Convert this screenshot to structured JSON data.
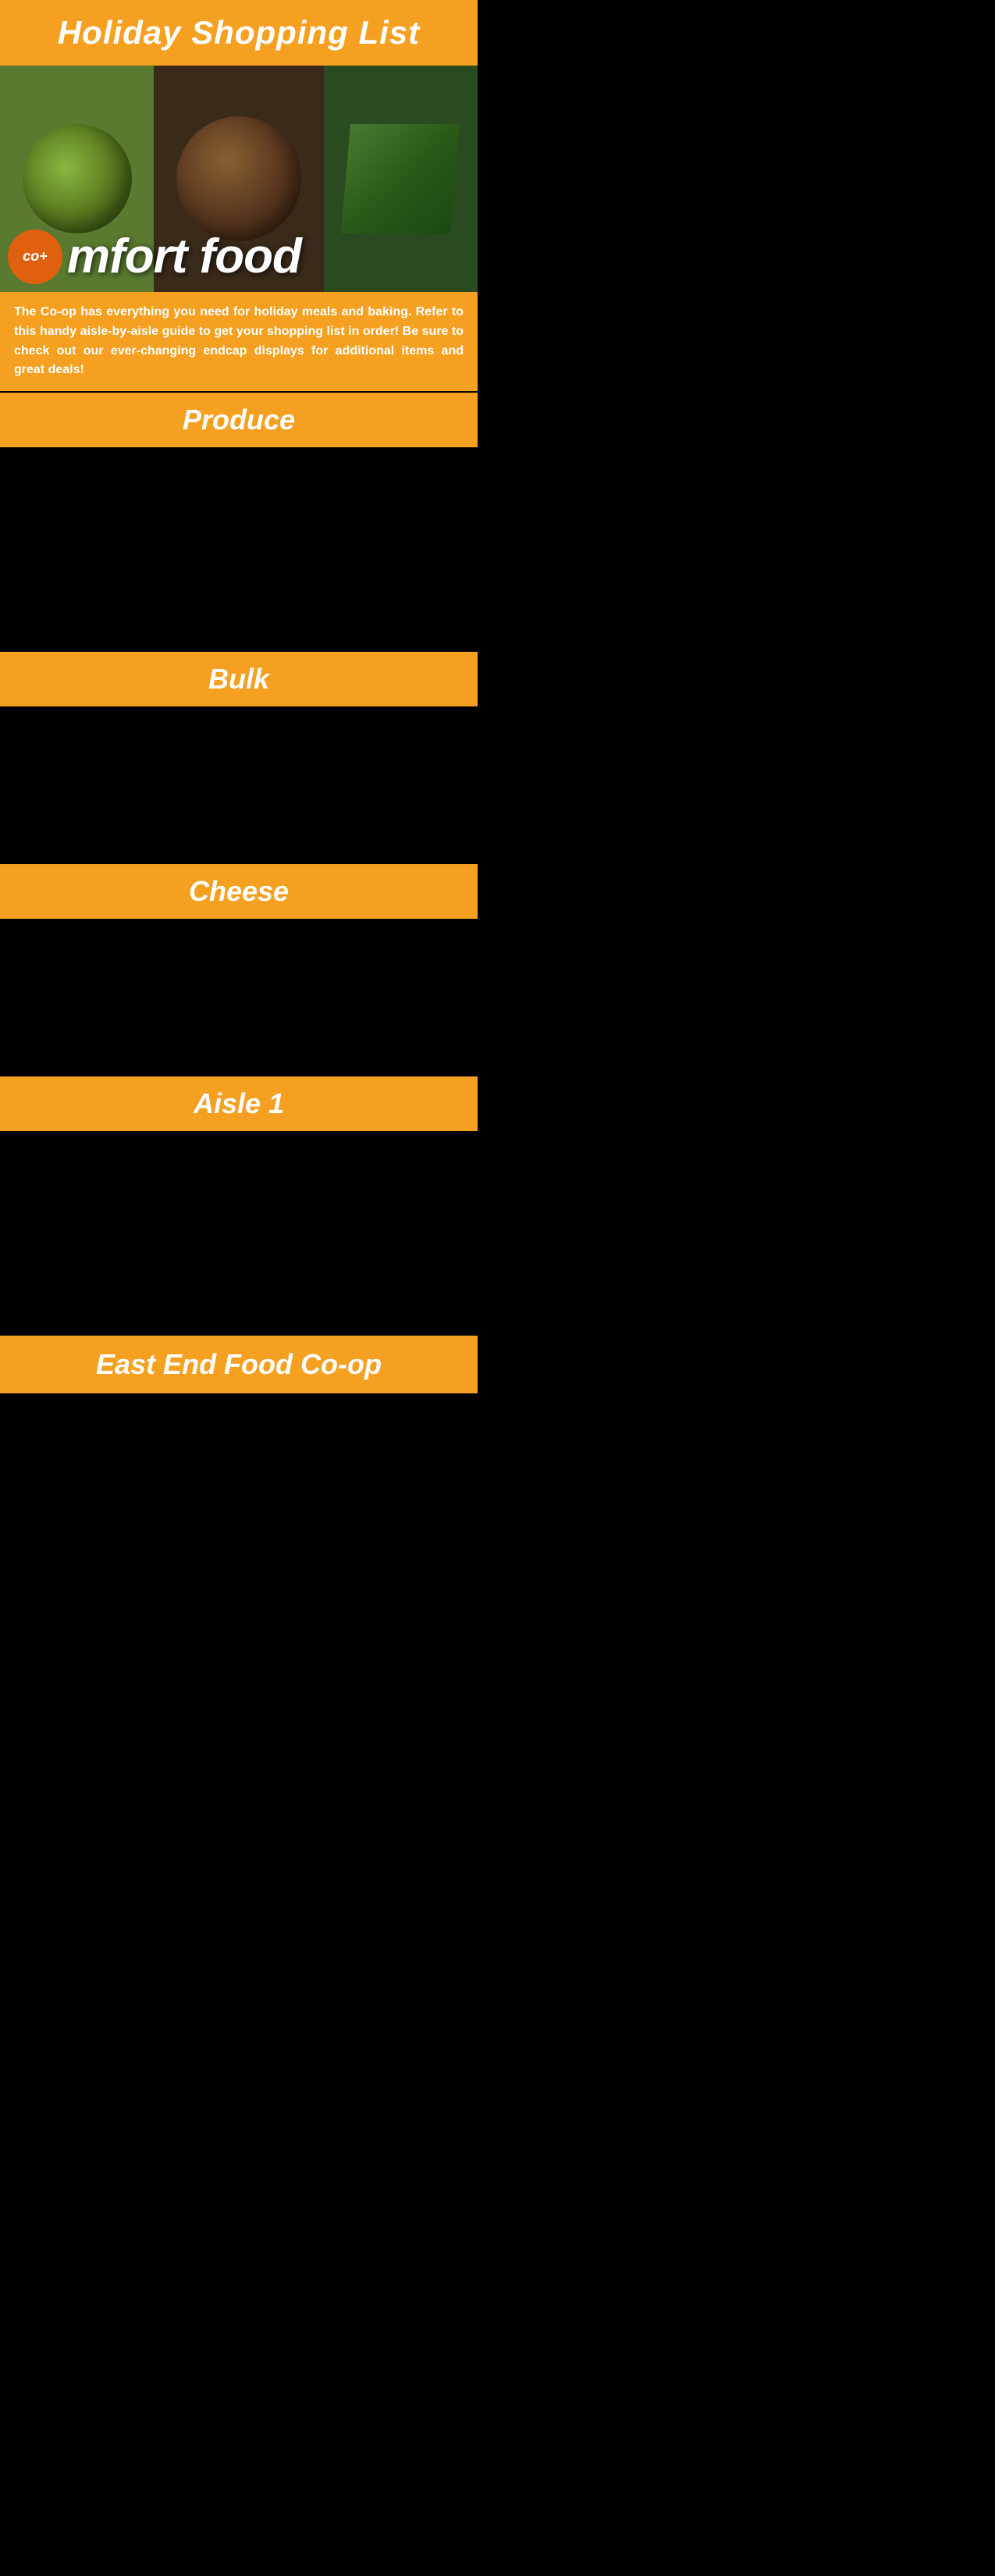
{
  "header": {
    "title": "Holiday Shopping List"
  },
  "hero": {
    "logo_text": "co+",
    "comfort_food_text": "mfort food"
  },
  "description": {
    "text": "The Co-op has everything you need for holiday meals and baking. Refer to this handy aisle-by-aisle guide to get your shopping list in order! Be sure to check out our ever-changing endcap displays for additional items and great deals!"
  },
  "sections": [
    {
      "id": "produce",
      "label": "Produce",
      "items": []
    },
    {
      "id": "bulk",
      "label": "Bulk",
      "items": []
    },
    {
      "id": "cheese",
      "label": "Cheese",
      "items": []
    },
    {
      "id": "aisle1",
      "label": "Aisle 1",
      "items": []
    }
  ],
  "footer": {
    "label": "East End Food Co-op"
  },
  "colors": {
    "orange": "#f5a020",
    "dark_orange": "#e06010",
    "white": "#ffffff",
    "black": "#000000"
  }
}
